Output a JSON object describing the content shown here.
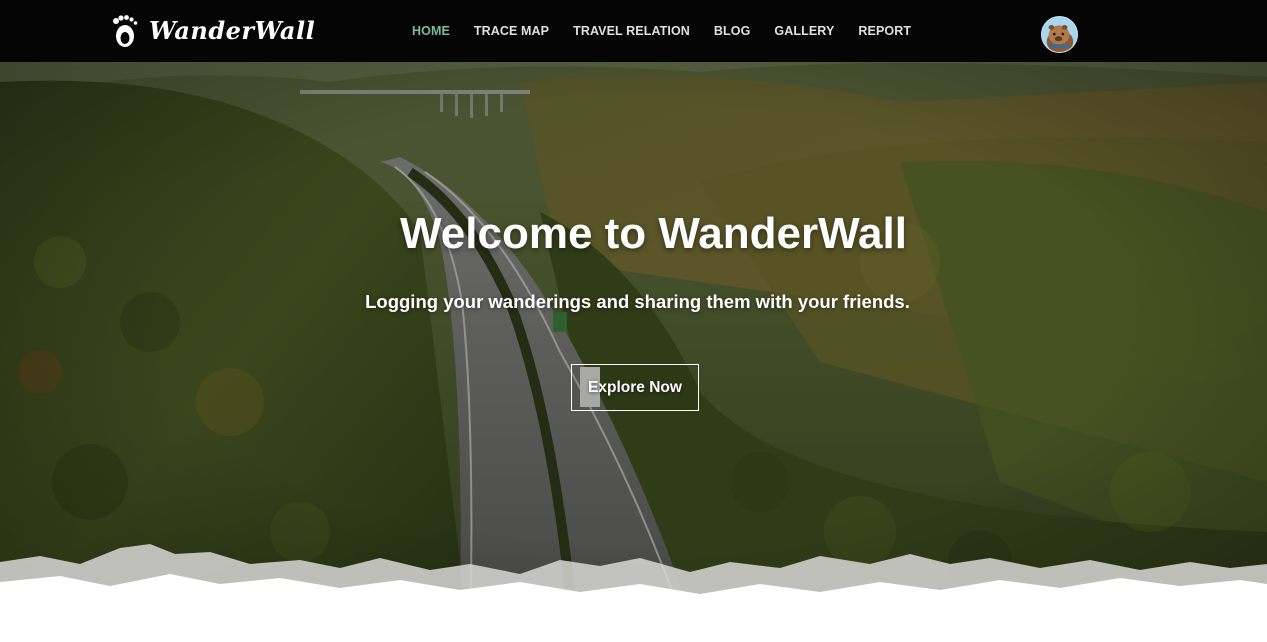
{
  "header": {
    "brand_name": "WanderWall",
    "brand_icon": "footprints-icon",
    "nav": [
      {
        "label": "HOME",
        "active": true
      },
      {
        "label": "TRACE MAP",
        "active": false
      },
      {
        "label": "TRAVEL RELATION",
        "active": false
      },
      {
        "label": "BLOG",
        "active": false
      },
      {
        "label": "GALLERY",
        "active": false
      },
      {
        "label": "REPORT",
        "active": false
      }
    ],
    "avatar_icon": "capybara-avatar-icon"
  },
  "hero": {
    "title": "Welcome to WanderWall",
    "subtitle": "Logging your wanderings and sharing them with your friends.",
    "cta_label": "Explore Now",
    "background": "aerial-highway-through-forest-image"
  },
  "colors": {
    "header_bg": "#050505",
    "nav_active": "#7fb9a0",
    "nav_text": "#e0e0e0",
    "hero_text": "#ffffff"
  }
}
